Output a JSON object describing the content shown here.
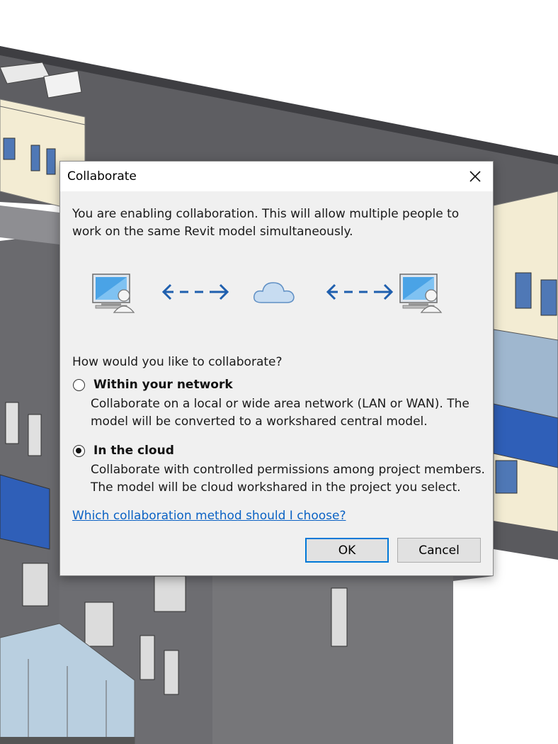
{
  "dialog": {
    "title": "Collaborate",
    "intro": "You are enabling collaboration. This will allow multiple people to work on the same Revit model simultaneously.",
    "question": "How would you like to collaborate?",
    "options": [
      {
        "label": "Within your network",
        "description": "Collaborate on a local or wide area network (LAN or WAN). The model will be converted to a workshared central model.",
        "selected": false
      },
      {
        "label": "In the cloud",
        "description": "Collaborate with controlled permissions among project members. The model will be cloud workshared in the project you select.",
        "selected": true
      }
    ],
    "help_link": "Which collaboration method should I choose?",
    "ok_label": "OK",
    "cancel_label": "Cancel"
  },
  "icons": {
    "close": "close-icon",
    "computer_user": "computer-user-icon",
    "arrow": "double-arrow-icon",
    "cloud": "cloud-icon"
  },
  "colors": {
    "link": "#0b62c4",
    "arrow": "#1f5fae",
    "focus_border": "#0078d7",
    "dialog_bg": "#f0f0f0"
  }
}
